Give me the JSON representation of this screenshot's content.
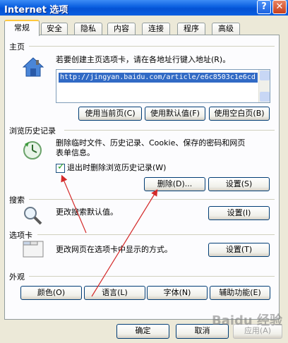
{
  "window": {
    "title": "Internet 选项",
    "help": "?",
    "close": "✕"
  },
  "tabs": [
    {
      "label": "常规",
      "active": true
    },
    {
      "label": "安全"
    },
    {
      "label": "隐私"
    },
    {
      "label": "内容"
    },
    {
      "label": "连接"
    },
    {
      "label": "程序"
    },
    {
      "label": "高级"
    }
  ],
  "home": {
    "section": "主页",
    "description": "若要创建主页选项卡，请在各地址行键入地址(R)。",
    "url": "http://jingyan.baidu.com/article/e6c8503c1e6cd",
    "btn_current": "使用当前页(C)",
    "btn_default": "使用默认值(F)",
    "btn_blank": "使用空白页(B)"
  },
  "history": {
    "section": "浏览历史记录",
    "description_line1": "删除临时文件、历史记录、Cookie、保存的密码和网页",
    "description_line2": "表单信息。",
    "checkbox_label": "退出时删除浏览历史记录(W)",
    "checked": true,
    "btn_delete": "删除(D)...",
    "btn_settings": "设置(S)"
  },
  "search": {
    "section": "搜索",
    "description": "更改搜索默认值。",
    "btn_settings": "设置(I)"
  },
  "tabsection": {
    "section": "选项卡",
    "description": "更改网页在选项卡中显示的方式。",
    "btn_settings": "设置(T)"
  },
  "appearance": {
    "section": "外观",
    "btn_colors": "颜色(O)",
    "btn_languages": "语言(L)",
    "btn_fonts": "字体(N)",
    "btn_accessibility": "辅助功能(E)"
  },
  "footer": {
    "ok": "确定",
    "cancel": "取消",
    "apply": "应用(A)"
  },
  "watermark": "Baidu 经验",
  "colors": {
    "annotation_arrow": "#d42a2a",
    "titlebar": "#0a5fe0"
  }
}
